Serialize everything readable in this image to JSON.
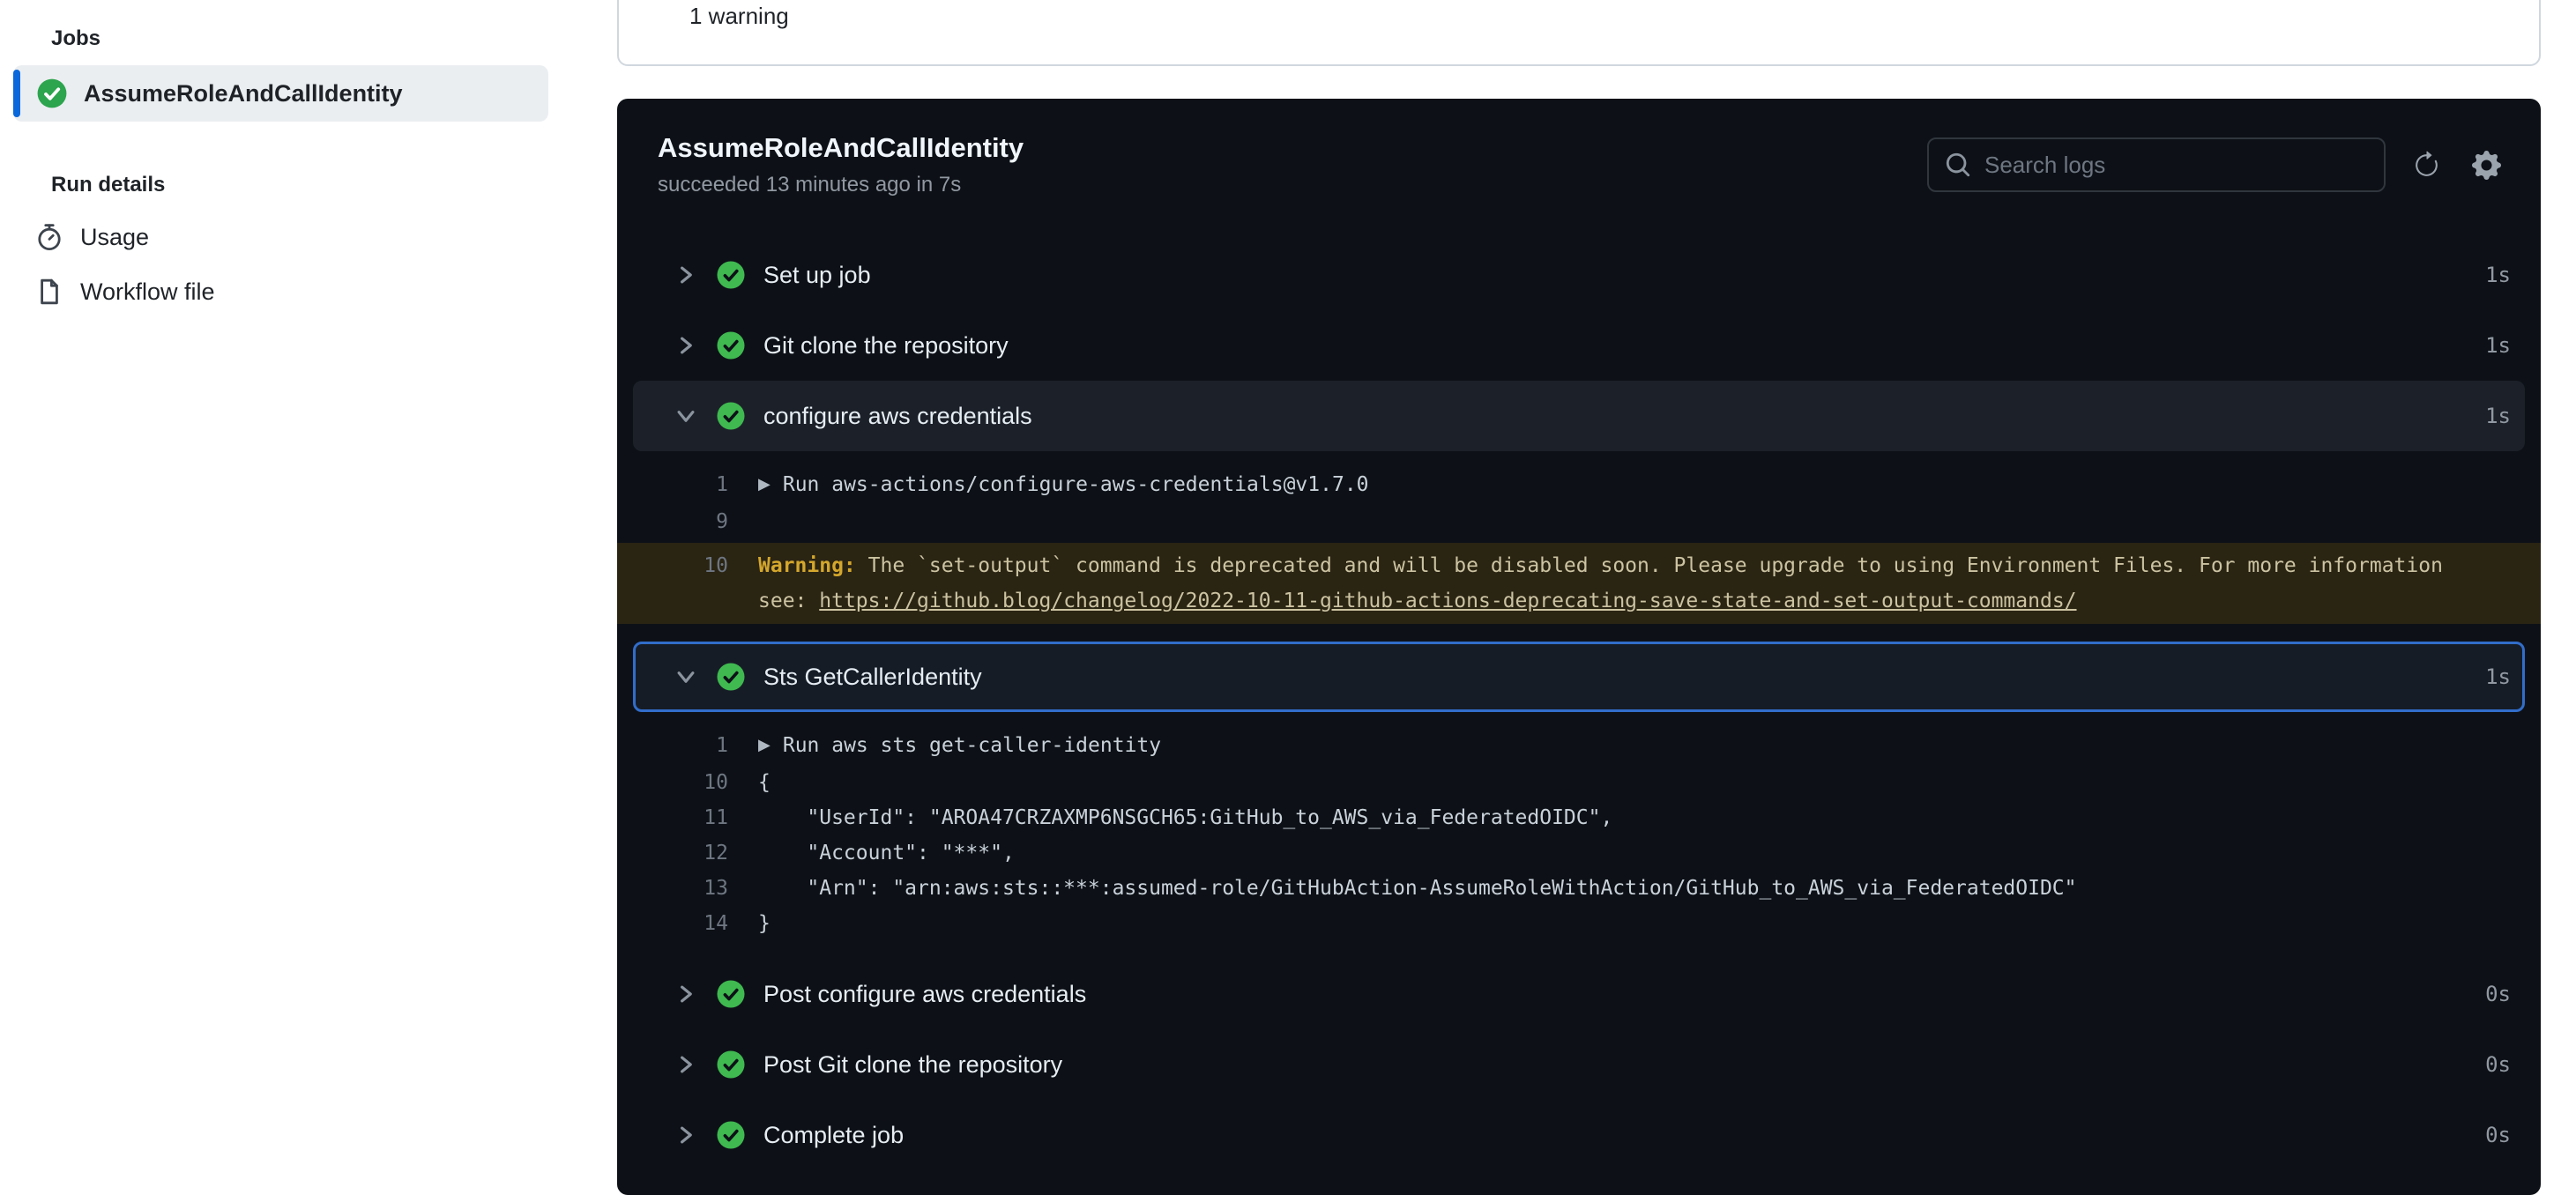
{
  "sidebar": {
    "jobs_header": "Jobs",
    "job": {
      "name": "AssumeRoleAndCallIdentity",
      "status": "success"
    },
    "run_details_header": "Run details",
    "usage_label": "Usage",
    "workflow_file_label": "Workflow file"
  },
  "summary_card": {
    "warnings_label": "1 warning"
  },
  "log_panel": {
    "title": "AssumeRoleAndCallIdentity",
    "subtitle": "succeeded 13 minutes ago in 7s",
    "search": {
      "placeholder": "Search logs"
    },
    "steps": [
      {
        "name": "Set up job",
        "duration": "1s",
        "state": "collapsed"
      },
      {
        "name": "Git clone the repository",
        "duration": "1s",
        "state": "collapsed"
      },
      {
        "name": "configure aws credentials",
        "duration": "1s",
        "state": "expanded",
        "lines": [
          {
            "no": "1",
            "text": "Run aws-actions/configure-aws-credentials@v1.7.0"
          },
          {
            "no": "9",
            "text": ""
          },
          {
            "no": "10",
            "warning_label": "Warning:",
            "warning_text": "The `set-output` command is deprecated and will be disabled soon. Please upgrade to using Environment Files. For more information see:",
            "warning_link": "https://github.blog/changelog/2022-10-11-github-actions-deprecating-save-state-and-set-output-commands/"
          }
        ]
      },
      {
        "name": "Sts GetCallerIdentity",
        "duration": "1s",
        "state": "expanded-selected",
        "lines": [
          {
            "no": "1",
            "text": "Run aws sts get-caller-identity"
          },
          {
            "no": "10",
            "text": "{"
          },
          {
            "no": "11",
            "text": "    \"UserId\": \"AROA47CRZAXMP6NSGCH65:GitHub_to_AWS_via_FederatedOIDC\","
          },
          {
            "no": "12",
            "text": "    \"Account\": \"***\","
          },
          {
            "no": "13",
            "text": "    \"Arn\": \"arn:aws:sts::***:assumed-role/GitHubAction-AssumeRoleWithAction/GitHub_to_AWS_via_FederatedOIDC\""
          },
          {
            "no": "14",
            "text": "}"
          }
        ]
      },
      {
        "name": "Post configure aws credentials",
        "duration": "0s",
        "state": "collapsed"
      },
      {
        "name": "Post Git clone the repository",
        "duration": "0s",
        "state": "collapsed"
      },
      {
        "name": "Complete job",
        "duration": "0s",
        "state": "collapsed"
      }
    ]
  },
  "colors": {
    "accent_blue": "#0969da",
    "selected_step_border": "#316dca",
    "success_green_sidebar": "#2da44e",
    "success_green_panel": "#3fb950",
    "warning_yellow": "#d4a72c",
    "warning_bg": "#2a2413",
    "panel_bg": "#0d1117"
  }
}
